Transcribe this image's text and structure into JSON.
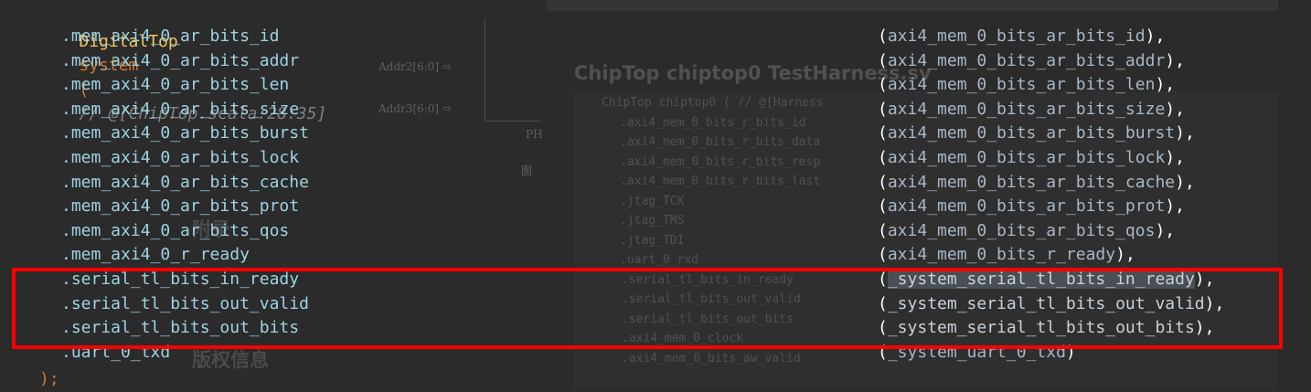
{
  "header": {
    "module": "DigitalTop",
    "instance": "system",
    "paren_open": "(",
    "comment": "// @[ChipTop.scala:28:35]"
  },
  "ports": [
    {
      "port": ".mem_axi4_0_ar_bits_id",
      "signal": "axi4_mem_0_bits_ar_bits_id",
      "tail": ","
    },
    {
      "port": ".mem_axi4_0_ar_bits_addr",
      "signal": "axi4_mem_0_bits_ar_bits_addr",
      "tail": ","
    },
    {
      "port": ".mem_axi4_0_ar_bits_len",
      "signal": "axi4_mem_0_bits_ar_bits_len",
      "tail": ","
    },
    {
      "port": ".mem_axi4_0_ar_bits_size",
      "signal": "axi4_mem_0_bits_ar_bits_size",
      "tail": ","
    },
    {
      "port": ".mem_axi4_0_ar_bits_burst",
      "signal": "axi4_mem_0_bits_ar_bits_burst",
      "tail": ","
    },
    {
      "port": ".mem_axi4_0_ar_bits_lock",
      "signal": "axi4_mem_0_bits_ar_bits_lock",
      "tail": ","
    },
    {
      "port": ".mem_axi4_0_ar_bits_cache",
      "signal": "axi4_mem_0_bits_ar_bits_cache",
      "tail": ","
    },
    {
      "port": ".mem_axi4_0_ar_bits_prot",
      "signal": "axi4_mem_0_bits_ar_bits_prot",
      "tail": ","
    },
    {
      "port": ".mem_axi4_0_ar_bits_qos",
      "signal": "axi4_mem_0_bits_ar_bits_qos",
      "tail": ","
    },
    {
      "port": ".mem_axi4_0_r_ready",
      "signal": "axi4_mem_0_bits_r_ready",
      "tail": ","
    },
    {
      "port": ".serial_tl_bits_in_ready",
      "signal": "_system_serial_tl_bits_in_ready",
      "tail": ","
    },
    {
      "port": ".serial_tl_bits_out_valid",
      "signal": "_system_serial_tl_bits_out_valid",
      "tail": ","
    },
    {
      "port": ".serial_tl_bits_out_bits",
      "signal": "_system_serial_tl_bits_out_bits",
      "tail": ","
    },
    {
      "port": ".uart_0_txd",
      "signal": "_system_uart_0_txd",
      "tail": ""
    }
  ],
  "closing": ");",
  "background_overlay": {
    "title": "ChipTop chiptop0 TestHarness.sv",
    "labels": [
      "Addr2[6:0]",
      "Addr3[6:0]",
      "PH",
      "图",
      "附录",
      "版权信息"
    ],
    "faint_lines": [
      "ChipTop chiptop0 (  // @[Harness",
      ".axi4_mem_0_bits_r_bits_id",
      ".axi4_mem_0_bits_r_bits_data",
      ".axi4_mem_0_bits_r_bits_resp",
      ".axi4_mem_0_bits_r_bits_last",
      ".jtag_TCK",
      ".jtag_TMS",
      ".jtag_TDI",
      ".uart_0_rxd",
      ".serial_tl_bits_in_ready",
      ".serial_tl_bits_out_valid",
      ".serial_tl_bits_out_bits",
      ".axi4_mem_0_clock",
      ".axi4_mem_0_bits_aw_valid"
    ]
  },
  "highlight": {
    "color": "#ff0000",
    "selected_signal": "_system_serial_tl_bits_in_ready"
  }
}
